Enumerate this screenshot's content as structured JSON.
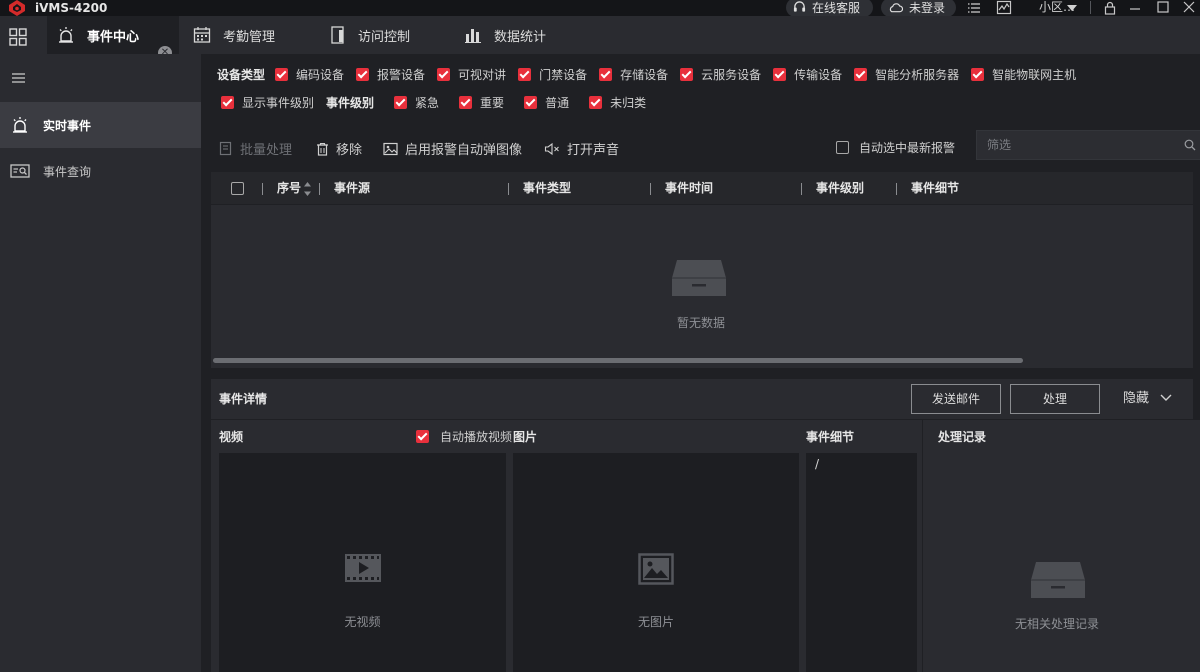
{
  "titlebar": {
    "app_title": "iVMS-4200",
    "support_label": "在线客服",
    "login_label": "未登录",
    "user_label": "小区…",
    "brand_color": "#e03030"
  },
  "tabs": [
    {
      "label": "事件中心",
      "active": true
    },
    {
      "label": "考勤管理"
    },
    {
      "label": "访问控制"
    },
    {
      "label": "数据统计"
    }
  ],
  "sidebar": {
    "items": [
      {
        "label": "实时事件",
        "active": true
      },
      {
        "label": "事件查询"
      }
    ]
  },
  "filters": {
    "device_type_label": "设备类型",
    "device_types": [
      "编码设备",
      "报警设备",
      "可视对讲",
      "门禁设备",
      "存储设备",
      "云服务设备",
      "传输设备",
      "智能分析服务器",
      "智能物联网主机"
    ],
    "show_level_label": "显示事件级别",
    "event_level_label": "事件级别",
    "event_levels": [
      "紧急",
      "重要",
      "普通",
      "未归类"
    ]
  },
  "toolbar": {
    "batch_label": "批量处理",
    "remove_label": "移除",
    "popup_label": "启用报警自动弹图像",
    "sound_label": "打开声音",
    "auto_select_label": "自动选中最新报警",
    "filter_placeholder": "筛选"
  },
  "table": {
    "columns": [
      "序号",
      "事件源",
      "事件类型",
      "事件时间",
      "事件级别",
      "事件细节"
    ],
    "rows": [],
    "empty_text": "暂无数据"
  },
  "details": {
    "title": "事件详情",
    "send_mail_label": "发送邮件",
    "handle_label": "处理",
    "hide_label": "隐藏",
    "video_label": "视频",
    "autoplay_label": "自动播放视频",
    "image_label": "图片",
    "event_detail_label": "事件细节",
    "no_video_text": "无视频",
    "no_image_text": "无图片",
    "event_detail_value": "/",
    "records_title": "处理记录",
    "no_records_text": "无相关处理记录"
  },
  "colors": {
    "accent": "#e8303c",
    "background": "#1f2024",
    "panel": "#2a2b30"
  }
}
